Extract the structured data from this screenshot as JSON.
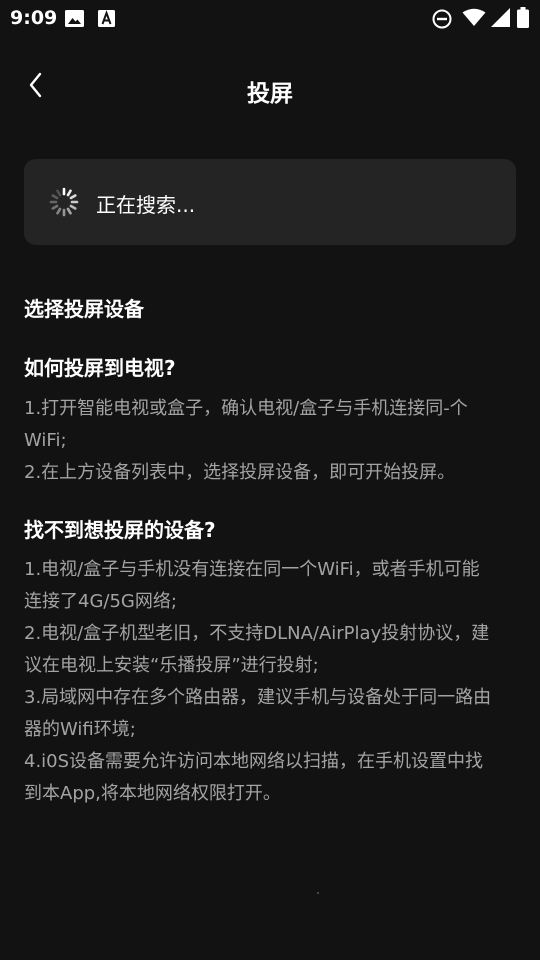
{
  "status_bar": {
    "time": "9:09"
  },
  "header": {
    "title": "投屏"
  },
  "search": {
    "status": "正在搜索..."
  },
  "content": {
    "select_title": "选择投屏设备",
    "howto_title": "如何投屏到电视?",
    "howto_lines": [
      "1.打开智能电视或盒子，确认电视/盒子与手机连接同-个",
      "WiFi;",
      "2.在上方设备列表中，选择投屏设备，即可开始投屏。"
    ],
    "notfound_title": "找不到想投屏的设备?",
    "notfound_lines": [
      "1.电视/盒子与手机没有连接在同一个WiFi，或者手机可能",
      "连接了4G/5G网络;",
      "2.电视/盒子机型老旧，不支持DLNA/AirPlay投射协议，建",
      "议在电视上安装“乐播投屏”进行投射;",
      "3.局域网中存在多个路由器，建议手机与设备处于同一路由",
      "器的Wifi环境;",
      "4.i0S设备需要允许访问本地网络以扫描，在手机设置中找",
      "到本App,将本地网络权限打开。"
    ]
  },
  "icons": {
    "status_left": [
      "image-icon",
      "font-icon"
    ],
    "status_right": [
      "do-not-disturb-icon",
      "wifi-icon",
      "signal-icon",
      "battery-icon"
    ],
    "back": "chevron-left-icon",
    "spinner": "loading-spinner-icon"
  },
  "colors": {
    "background": "#121212",
    "card": "#242424",
    "primary_text": "#ffffff",
    "secondary_text": "#a3a3a3"
  }
}
